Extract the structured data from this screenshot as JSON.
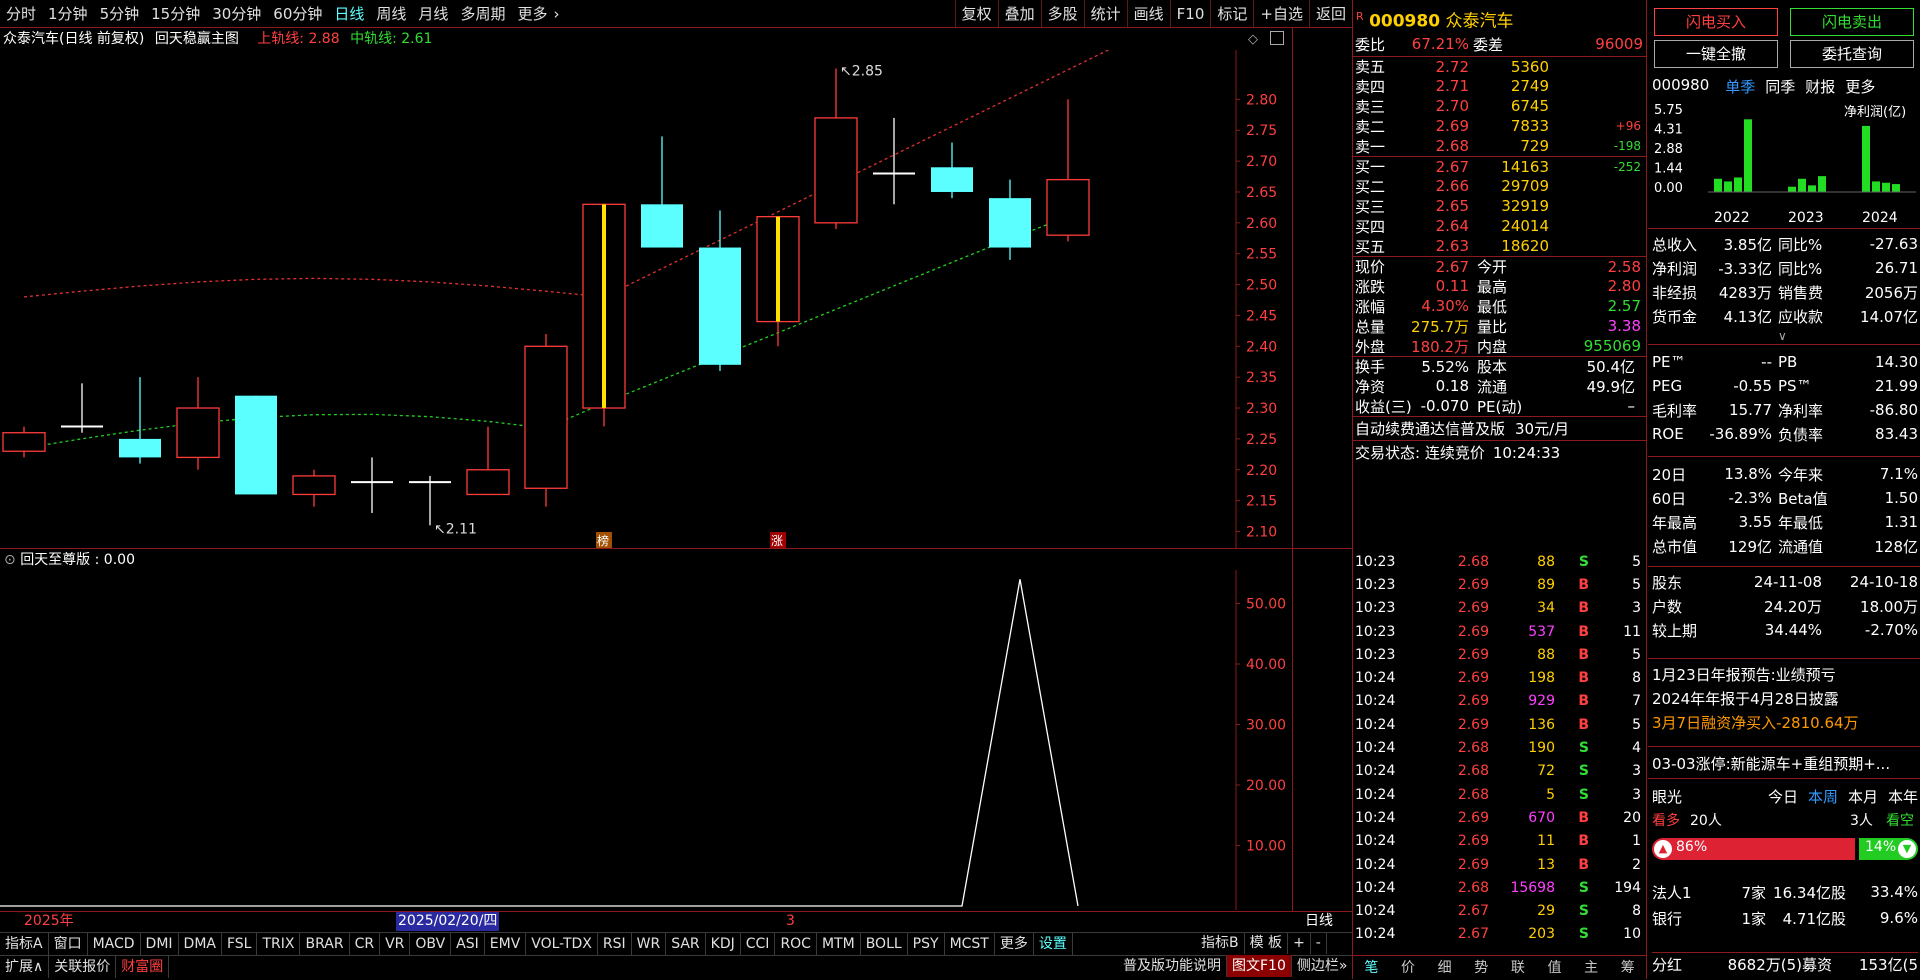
{
  "toolbar": {
    "periods": [
      "分时",
      "1分钟",
      "5分钟",
      "15分钟",
      "30分钟",
      "60分钟",
      "日线",
      "周线",
      "月线",
      "多周期",
      "更多"
    ],
    "active_period": "日线",
    "more_arrow": "›",
    "right": [
      "复权",
      "叠加",
      "多股",
      "统计",
      "画线",
      "F10",
      "标记",
      "+自选",
      "返回"
    ]
  },
  "chart_header": {
    "title": "众泰汽车(日线 前复权)",
    "indicator": "回天稳赢主图",
    "up_label": "上轨线: 2.88",
    "mid_label": "中轨线: 2.61"
  },
  "price_axis": [
    "2.80",
    "2.75",
    "2.70",
    "2.65",
    "2.60",
    "2.55",
    "2.50",
    "2.45",
    "2.40",
    "2.35",
    "2.30",
    "2.25",
    "2.20",
    "2.15",
    "2.10"
  ],
  "annotations": {
    "high": "2.85",
    "low": "2.11",
    "marker1": "榜",
    "marker2": "涨"
  },
  "sub_header": {
    "label": "回天至尊版 : 0.00"
  },
  "sub_axis": [
    "50.00",
    "40.00",
    "30.00",
    "20.00",
    "10.00"
  ],
  "date_axis": {
    "year": "2025年",
    "cursor": "2025/02/20/四",
    "month": "3",
    "period": "日线"
  },
  "candles": [
    {
      "o": 2.26,
      "c": 2.23,
      "h": 2.27,
      "l": 2.22,
      "up": true
    },
    {
      "o": 2.26,
      "c": 2.27,
      "h": 2.34,
      "l": 2.26,
      "up": false
    },
    {
      "o": 2.25,
      "c": 2.22,
      "h": 2.35,
      "l": 2.21,
      "up": false
    },
    {
      "o": 2.22,
      "c": 2.3,
      "h": 2.35,
      "l": 2.2,
      "up": true
    },
    {
      "o": 2.32,
      "c": 2.16,
      "h": 2.32,
      "l": 2.16,
      "up": false
    },
    {
      "o": 2.16,
      "c": 2.19,
      "h": 2.2,
      "l": 2.14,
      "up": true
    },
    {
      "o": 2.18,
      "c": 2.18,
      "h": 2.22,
      "l": 2.13,
      "up": false
    },
    {
      "o": 2.18,
      "c": 2.17,
      "h": 2.19,
      "l": 2.11,
      "up": false
    },
    {
      "o": 2.16,
      "c": 2.2,
      "h": 2.27,
      "l": 2.16,
      "up": true
    },
    {
      "o": 2.17,
      "c": 2.4,
      "h": 2.42,
      "l": 2.14,
      "up": true
    },
    {
      "o": 2.3,
      "c": 2.63,
      "h": 2.63,
      "l": 2.27,
      "up": true,
      "limit": true
    },
    {
      "o": 2.63,
      "c": 2.56,
      "h": 2.74,
      "l": 2.56,
      "up": false
    },
    {
      "o": 2.56,
      "c": 2.37,
      "h": 2.62,
      "l": 2.36,
      "up": false
    },
    {
      "o": 2.44,
      "c": 2.61,
      "h": 2.61,
      "l": 2.4,
      "up": true,
      "limit": true
    },
    {
      "o": 2.6,
      "c": 2.77,
      "h": 2.85,
      "l": 2.59,
      "up": true
    },
    {
      "o": 2.68,
      "c": 2.67,
      "h": 2.77,
      "l": 2.63,
      "up": false
    },
    {
      "o": 2.69,
      "c": 2.65,
      "h": 2.73,
      "l": 2.64,
      "up": false
    },
    {
      "o": 2.64,
      "c": 2.56,
      "h": 2.67,
      "l": 2.54,
      "up": false
    },
    {
      "o": 2.58,
      "c": 2.67,
      "h": 2.8,
      "l": 2.57,
      "up": true
    }
  ],
  "toolbar2": [
    "指标A",
    "窗口",
    "MACD",
    "DMI",
    "DMA",
    "FSL",
    "TRIX",
    "BRAR",
    "CR",
    "VR",
    "OBV",
    "ASI",
    "EMV",
    "VOL-TDX",
    "RSI",
    "WR",
    "SAR",
    "KDJ",
    "CCI",
    "ROC",
    "MTM",
    "BOLL",
    "PSY",
    "MCST",
    "更多",
    "设置"
  ],
  "toolbar2_active": "设置",
  "toolbar2_right": [
    "指标B",
    "模 板",
    "+",
    "-"
  ],
  "toolbar3": [
    "扩展∧",
    "关联报价",
    "财富圈"
  ],
  "toolbar3_right": [
    "普及版功能说明",
    "图文F10",
    "侧边栏»"
  ],
  "stock": {
    "badge": "R",
    "code": "000980",
    "name": "众泰汽车"
  },
  "weibi": {
    "l1": "委比",
    "v1": "67.21%",
    "l2": "委差",
    "v2": "96009"
  },
  "sells": [
    [
      "卖五",
      "2.72",
      "5360",
      ""
    ],
    [
      "卖四",
      "2.71",
      "2749",
      ""
    ],
    [
      "卖三",
      "2.70",
      "6745",
      ""
    ],
    [
      "卖二",
      "2.69",
      "7833",
      "+96"
    ],
    [
      "卖一",
      "2.68",
      "729",
      "-198"
    ]
  ],
  "buys": [
    [
      "买一",
      "2.67",
      "14163",
      "-252"
    ],
    [
      "买二",
      "2.66",
      "29709",
      ""
    ],
    [
      "买三",
      "2.65",
      "32919",
      ""
    ],
    [
      "买四",
      "2.64",
      "24014",
      ""
    ],
    [
      "买五",
      "2.63",
      "18620",
      ""
    ]
  ],
  "stats": [
    [
      "现价",
      "2.67",
      "今开",
      "2.58"
    ],
    [
      "涨跌",
      "0.11",
      "最高",
      "2.80"
    ],
    [
      "涨幅",
      "4.30%",
      "最低",
      "2.57"
    ],
    [
      "总量",
      "275.7万",
      "量比",
      "3.38"
    ],
    [
      "外盘",
      "180.2万",
      "内盘",
      "955069"
    ]
  ],
  "stats2": [
    [
      "换手",
      "5.52%",
      "股本",
      "50.4亿"
    ],
    [
      "净资",
      "0.18",
      "流通",
      "49.9亿"
    ],
    [
      "收益(三)",
      "-0.070",
      "PE(动)",
      "–"
    ]
  ],
  "promo": {
    "text": "自动续费通达信普及版",
    "price": "30元/月"
  },
  "trade_status": {
    "text": "交易状态: 连续竞价",
    "time": "10:24:33"
  },
  "ticks": [
    [
      "10:23",
      "2.68",
      "88",
      "S",
      "5"
    ],
    [
      "10:23",
      "2.69",
      "89",
      "B",
      "5"
    ],
    [
      "10:23",
      "2.69",
      "34",
      "B",
      "3"
    ],
    [
      "10:23",
      "2.69",
      "537",
      "B",
      "11"
    ],
    [
      "10:23",
      "2.69",
      "88",
      "B",
      "5"
    ],
    [
      "10:24",
      "2.69",
      "198",
      "B",
      "8"
    ],
    [
      "10:24",
      "2.69",
      "929",
      "B",
      "7"
    ],
    [
      "10:24",
      "2.69",
      "136",
      "B",
      "5"
    ],
    [
      "10:24",
      "2.68",
      "190",
      "S",
      "4"
    ],
    [
      "10:24",
      "2.68",
      "72",
      "S",
      "3"
    ],
    [
      "10:24",
      "2.68",
      "5",
      "S",
      "3"
    ],
    [
      "10:24",
      "2.69",
      "670",
      "B",
      "20"
    ],
    [
      "10:24",
      "2.69",
      "11",
      "B",
      "1"
    ],
    [
      "10:24",
      "2.69",
      "13",
      "B",
      "2"
    ],
    [
      "10:24",
      "2.68",
      "15698",
      "S",
      "194"
    ],
    [
      "10:24",
      "2.67",
      "29",
      "S",
      "8"
    ],
    [
      "10:24",
      "2.67",
      "203",
      "S",
      "10"
    ]
  ],
  "mid_tabs": [
    "笔",
    "价",
    "细",
    "势",
    "联",
    "值",
    "主",
    "筹"
  ],
  "right": {
    "btn_buy": "闪电买入",
    "btn_sell": "闪电卖出",
    "btn_cancel": "一键全撤",
    "btn_query": "委托查询",
    "tabs": [
      "000980",
      "单季",
      "同季",
      "财报",
      "更多"
    ],
    "chart_label": "净利润(亿)",
    "y_ticks": [
      "5.75",
      "4.31",
      "2.88",
      "1.44",
      "0.00"
    ],
    "years": [
      "2022",
      "2023",
      "2024"
    ],
    "bars": [
      1.0,
      0.8,
      1.1,
      5.5,
      0.4,
      1.0,
      0.5,
      1.2,
      5.0,
      0.8,
      0.7,
      0.6
    ],
    "fin": [
      [
        "总收入",
        "3.85亿",
        "同比%",
        "-27.63"
      ],
      [
        "净利润",
        "-3.33亿",
        "同比%",
        "26.71"
      ],
      [
        "非经损",
        "4283万",
        "销售费",
        "2056万"
      ],
      [
        "货币金",
        "4.13亿",
        "应收款",
        "14.07亿"
      ]
    ],
    "val": [
      [
        "PE™",
        "--",
        "PB",
        "14.30"
      ],
      [
        "PEG",
        "-0.55",
        "PS™",
        "21.99"
      ],
      [
        "毛利率",
        "15.77",
        "净利率",
        "-86.80"
      ],
      [
        "ROE",
        "-36.89%",
        "负债率",
        "83.43"
      ]
    ],
    "perf": [
      [
        "20日",
        "13.8%",
        "今年来",
        "7.1%"
      ],
      [
        "60日",
        "-2.3%",
        "Beta值",
        "1.50"
      ],
      [
        "年最高",
        "3.55",
        "年最低",
        "1.31"
      ],
      [
        "总市值",
        "129亿",
        "流通值",
        "128亿"
      ]
    ],
    "holders": [
      [
        "股东",
        "24-11-08",
        "24-10-18"
      ],
      [
        "户数",
        "24.20万",
        "18.00万"
      ],
      [
        "较上期",
        "34.44%",
        "-2.70%"
      ]
    ],
    "news": [
      "1月23日年报预告:业绩预亏",
      "2024年年报于4月28日披露",
      "3月7日融资净买入-2810.64万"
    ],
    "news2": "03-03涨停:新能源车+重组预期+...",
    "vision": {
      "label": "眼光",
      "tabs": [
        "今日",
        "本周",
        "本月",
        "本年"
      ],
      "bull": "看多",
      "bull_n": "20人",
      "bear_n": "3人",
      "bear": "看空",
      "bull_pct": "86%",
      "bear_pct": "14%"
    },
    "inst": [
      [
        "法人1",
        "7家",
        "16.34亿股",
        "33.4%"
      ],
      [
        "银行",
        "1家",
        "4.71亿股",
        "9.6%"
      ]
    ],
    "bottom": [
      "分红",
      "8682万(5)募资",
      "153亿(5"
    ]
  },
  "colors": {
    "up": "#ff3b3b",
    "down": "#5cffff",
    "upper_band": "#e03030",
    "mid_band": "#22cc22",
    "limit": "#ffe000"
  }
}
